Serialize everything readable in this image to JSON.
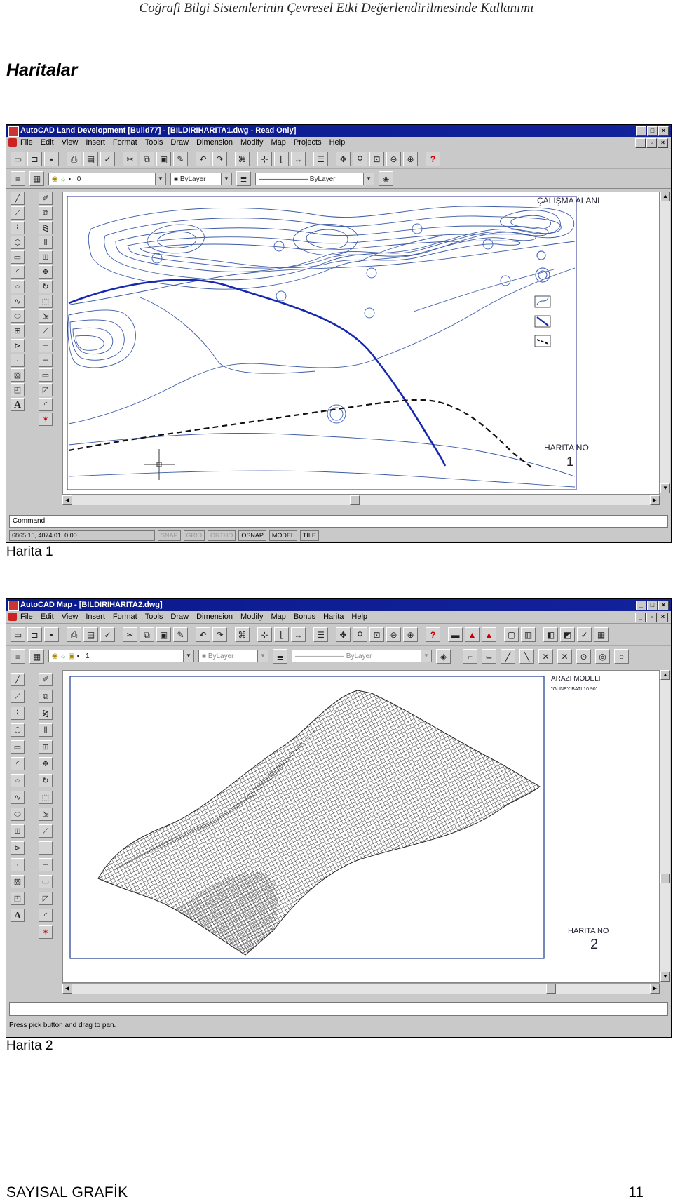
{
  "page": {
    "running_header": "Coğrafi Bilgi Sistemlerinin Çevresel Etki Değerlendirilmesinde Kullanımı",
    "section_title": "Haritalar",
    "footer_left": "SAYISAL GRAFİK",
    "page_number": "11"
  },
  "figures": [
    {
      "caption": "Harita 1",
      "window_title": "AutoCAD Land Development [Build77] - [BILDIRIHARITA1.dwg - Read Only]",
      "menu": [
        "File",
        "Edit",
        "View",
        "Insert",
        "Format",
        "Tools",
        "Draw",
        "Dimension",
        "Modify",
        "Map",
        "Projects",
        "Help"
      ],
      "layer_combo": "0",
      "color_combo": "ByLayer",
      "linetype_combo": "ByLayer",
      "map_title": "ÇALIŞMA ALANI",
      "map_label": "HARITA NO",
      "map_number": "1",
      "command_prompt": "Command:",
      "coords": "6865.15, 4074.01, 0.00",
      "status_toggles": [
        {
          "label": "SNAP",
          "active": false
        },
        {
          "label": "GRID",
          "active": false
        },
        {
          "label": "ORTHO",
          "active": false
        },
        {
          "label": "OSNAP",
          "active": true
        },
        {
          "label": "MODEL",
          "active": true
        },
        {
          "label": "TILE",
          "active": true
        }
      ],
      "icons": {
        "toolbar": [
          "new-icon",
          "open-icon",
          "save-icon",
          "print-icon",
          "preview-icon",
          "spell-icon",
          "cut-icon",
          "copy-icon",
          "paste-icon",
          "matchprop-icon",
          "undo-icon",
          "redo-icon",
          "hyperlink-icon",
          "snap-icon",
          "ucs-icon",
          "distance-icon",
          "pan-icon",
          "zoom-realtime-icon",
          "zoom-window-icon",
          "zoom-previous-icon",
          "aerial-view-icon",
          "help-icon"
        ],
        "draw": [
          "line-icon",
          "xline-icon",
          "polyline-icon",
          "polygon-icon",
          "rectangle-icon",
          "arc-icon",
          "circle-icon",
          "spline-icon",
          "ellipse-icon",
          "block-icon",
          "insert-icon",
          "point-icon",
          "hatch-icon",
          "region-icon",
          "text-icon"
        ],
        "modify": [
          "erase-icon",
          "copy-object-icon",
          "mirror-icon",
          "offset-icon",
          "array-icon",
          "move-icon",
          "rotate-icon",
          "scale-icon",
          "stretch-icon",
          "lengthen-icon",
          "trim-icon",
          "extend-icon",
          "break-icon",
          "chamfer-icon",
          "fillet-icon",
          "explode-icon"
        ]
      }
    },
    {
      "caption": "Harita 2",
      "window_title": "AutoCAD Map - [BILDIRIHARITA2.dwg]",
      "menu": [
        "File",
        "Edit",
        "View",
        "Insert",
        "Format",
        "Tools",
        "Draw",
        "Dimension",
        "Modify",
        "Map",
        "Bonus",
        "Harita",
        "Help"
      ],
      "layer_combo": "1",
      "color_combo": "ByLayer",
      "linetype_combo": "ByLayer",
      "map_title": "ARAZI MODELI",
      "map_subtitle": "\"GUNEY BATI 10 90\"",
      "map_label": "HARITA NO",
      "map_number": "2",
      "command_prompt": "Press pick button and drag to pan.",
      "icons": {
        "toolbar": [
          "new-icon",
          "open-icon",
          "save-icon",
          "print-icon",
          "preview-icon",
          "spell-icon",
          "cut-icon",
          "copy-icon",
          "paste-icon",
          "matchprop-icon",
          "undo-icon",
          "redo-icon",
          "hyperlink-icon",
          "snap-icon",
          "ucs-icon",
          "distance-icon",
          "pan-icon",
          "zoom-realtime-icon",
          "zoom-window-icon",
          "zoom-previous-icon",
          "aerial-view-icon",
          "help-icon",
          "map-tool-icon",
          "map-layer-icon",
          "map-query-icon",
          "map-attach-icon",
          "map-export-icon",
          "map-publish-icon"
        ]
      }
    }
  ]
}
